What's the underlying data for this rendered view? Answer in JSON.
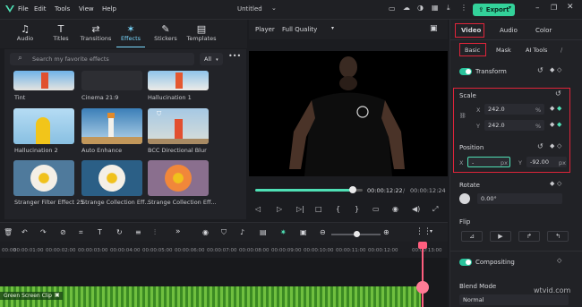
{
  "menubar": {
    "file": "File",
    "edit": "Edit",
    "tools": "Tools",
    "view": "View",
    "help": "Help",
    "title": "Untitled",
    "export": "Export"
  },
  "tabs": [
    {
      "label": "Audio",
      "icon": "music-note-icon"
    },
    {
      "label": "Titles",
      "icon": "title-icon"
    },
    {
      "label": "Transitions",
      "icon": "transition-icon"
    },
    {
      "label": "Effects",
      "icon": "effects-icon"
    },
    {
      "label": "Stickers",
      "icon": "sticker-icon"
    },
    {
      "label": "Templates",
      "icon": "templates-icon"
    }
  ],
  "search": {
    "placeholder": "Search my favorite effects",
    "filter": "All"
  },
  "effects": [
    {
      "name": "Tint"
    },
    {
      "name": "Cinema 21:9"
    },
    {
      "name": "Hallucination 1"
    },
    {
      "name": "Hallucination 2"
    },
    {
      "name": "Auto Enhance"
    },
    {
      "name": "BCC Directional Blur"
    },
    {
      "name": "Stranger Filter Effect 25"
    },
    {
      "name": "Strange Collection Eff..."
    },
    {
      "name": "Strange Collection Eff..."
    }
  ],
  "player": {
    "label": "Player",
    "quality": "Full Quality",
    "current_time": "00:00:12:22",
    "total_time": "00:00:12:24",
    "progress": 0.95
  },
  "timeline": {
    "ticks": [
      "00:00",
      "00:00:01:00",
      "00:00:02:00",
      "00:00:03:00",
      "00:00:04:00",
      "00:00:05:00",
      "00:00:06:00",
      "00:00:07:00",
      "00:00:08:00",
      "00:00:09:00",
      "00:00:10:00",
      "00:00:11:00",
      "00:00:12:00",
      "00:00:13:00"
    ],
    "clip_label": "Green Screen Clip"
  },
  "panel": {
    "tabs": {
      "video": "Video",
      "audio": "Audio",
      "color": "Color"
    },
    "subtabs": {
      "basic": "Basic",
      "mask": "Mask",
      "ai_tools": "AI Tools"
    },
    "transform": "Transform",
    "scale": "Scale",
    "scale_x_label": "X",
    "scale_x": "242.0",
    "scale_y_label": "Y",
    "scale_y": "242.0",
    "percent": "%",
    "position": "Position",
    "pos_x_label": "X",
    "pos_x": "-",
    "pos_y_label": "Y",
    "pos_y": "-92.00",
    "px": "px",
    "rotate": "Rotate",
    "rotate_value": "0.00°",
    "flip": "Flip",
    "compositing": "Compositing",
    "blend_mode": "Blend Mode",
    "blend_value": "Normal"
  },
  "colors": {
    "accent": "#33d29a",
    "highlight": "#e0243a",
    "teal": "#2ac39c",
    "playhead": "#ff5e7e"
  },
  "watermark": "wtvid.com"
}
